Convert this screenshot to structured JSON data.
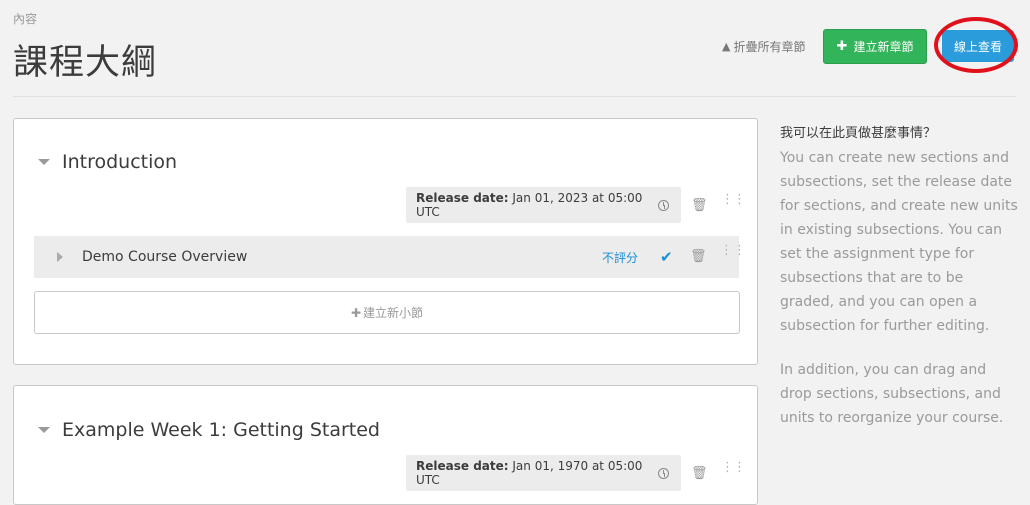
{
  "header": {
    "subtitle": "內容",
    "title": "課程大綱",
    "collapse_all": "折疊所有章節",
    "new_section_button": "建立新章節",
    "view_live_button": "線上查看"
  },
  "sections": [
    {
      "name": "Introduction",
      "release_label": "Release date:",
      "release_value": "Jan 01, 2023 at 05:00 UTC",
      "subsections": [
        {
          "name": "Demo Course Overview",
          "grading": "不評分"
        }
      ],
      "add_subsection": "建立新小節"
    },
    {
      "name": "Example Week 1: Getting Started",
      "release_label": "Release date:",
      "release_value": "Jan 01, 1970 at 05:00 UTC"
    }
  ],
  "help": {
    "title": "我可以在此頁做甚麼事情？",
    "paragraph1": "You can create new sections and subsections, set the release date for sections, and create new units in existing subsections. You can set the assignment type for subsections that are to be graded, and you can open a subsection for further editing.",
    "paragraph2": "In addition, you can drag and drop sections, subsections, and units to reorganize your course."
  },
  "icons": {
    "collapse": "arrow-up-icon",
    "add": "plus-icon",
    "clock": "clock-icon",
    "trash": "trash-icon",
    "drag": "drag-handle-icon",
    "check": "checkmark-icon"
  },
  "colors": {
    "primary_green": "#32b45a",
    "primary_blue": "#2a9cdb",
    "highlight_red": "#e0111b",
    "link_blue": "#1a8fd6"
  }
}
